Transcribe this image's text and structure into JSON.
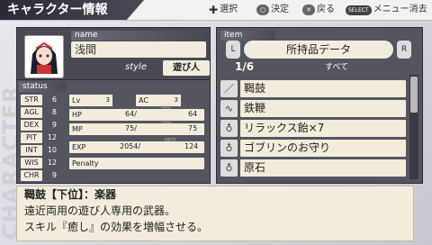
{
  "header": {
    "title": "キャラクター情報",
    "hints": [
      {
        "icon": "dpad-icon",
        "label": "選択"
      },
      {
        "icon": "circle-button-icon",
        "label": "決定"
      },
      {
        "icon": "cross-button-icon",
        "label": "戻る"
      },
      {
        "icon": "select-button-icon",
        "icon_text": "SELECT",
        "label": "メニュー消去"
      }
    ]
  },
  "watermark": "CHARACTER",
  "character": {
    "name_tab": "name",
    "name": "浅間",
    "style_label": "style",
    "style": "遊び人"
  },
  "status": {
    "tab": "status",
    "stats": [
      {
        "label": "STR",
        "value": "6"
      },
      {
        "label": "AGL",
        "value": "8"
      },
      {
        "label": "DEX",
        "value": "9"
      },
      {
        "label": "PIT",
        "value": "12"
      },
      {
        "label": "INT",
        "value": "10"
      },
      {
        "label": "WIS",
        "value": "12"
      },
      {
        "label": "CHR",
        "value": "9"
      }
    ],
    "lv_label": "Lv",
    "lv": "3",
    "ac_label": "AC",
    "ac": "3",
    "hp_label": "HP",
    "hp": "64",
    "hp_max": "64",
    "mp_label": "MP",
    "mp": "75",
    "mp_max": "75",
    "max_label": "MAX",
    "exp_label": "EXP",
    "exp": "2054",
    "exp_next": "124",
    "next_label": "NEXT",
    "penalty_label": "Penalty"
  },
  "items": {
    "tab": "item",
    "category": "所持品データ",
    "l_button": "L",
    "r_button": "R",
    "page": "1/6",
    "filter": "すべて",
    "list": [
      {
        "icon": "brush-icon",
        "name": "鞨鼓"
      },
      {
        "icon": "whip-icon",
        "name": "鉄鞭"
      },
      {
        "icon": "pouch-icon",
        "name": "リラックス飴×7"
      },
      {
        "icon": "pouch-icon",
        "name": "ゴブリンのお守り"
      },
      {
        "icon": "pouch-icon",
        "name": "原石"
      }
    ]
  },
  "description": {
    "title": "鞨鼓【下位】：楽器",
    "line1": "遠近両用の遊び人専用の武器。",
    "line2": "スキル『癒し』の効果を増幅させる。"
  }
}
